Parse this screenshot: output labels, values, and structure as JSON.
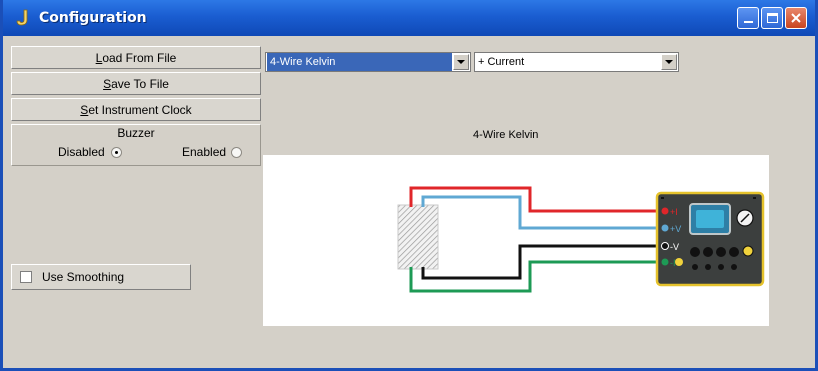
{
  "window": {
    "title": "Configuration",
    "colors": {
      "titlebar": "#1a5dd1",
      "face": "#d4d0c8"
    }
  },
  "buttons": {
    "load_label_accel": "L",
    "load_label_rest": "oad From File",
    "save_label_accel": "S",
    "save_label_rest": "ave To File",
    "clock_label_accel": "S",
    "clock_label_rest": "et Instrument Clock"
  },
  "buzzer": {
    "title": "Buzzer",
    "disabled_label": "Disabled",
    "enabled_label": "Enabled",
    "selected": "Disabled"
  },
  "smoothing": {
    "label": "Use Smoothing",
    "checked": false
  },
  "mode_select": {
    "value": "4-Wire Kelvin"
  },
  "polarity_select": {
    "value": "+ Current"
  },
  "diagram": {
    "title": "4-Wire Kelvin",
    "terminal_labels": [
      "+I",
      "+V",
      "-V",
      "-I"
    ],
    "wire_colors": {
      "current_plus": "#e0262a",
      "voltage_plus": "#5fa8d3",
      "voltage_minus": "#111111",
      "current_minus": "#1d9a55"
    }
  }
}
